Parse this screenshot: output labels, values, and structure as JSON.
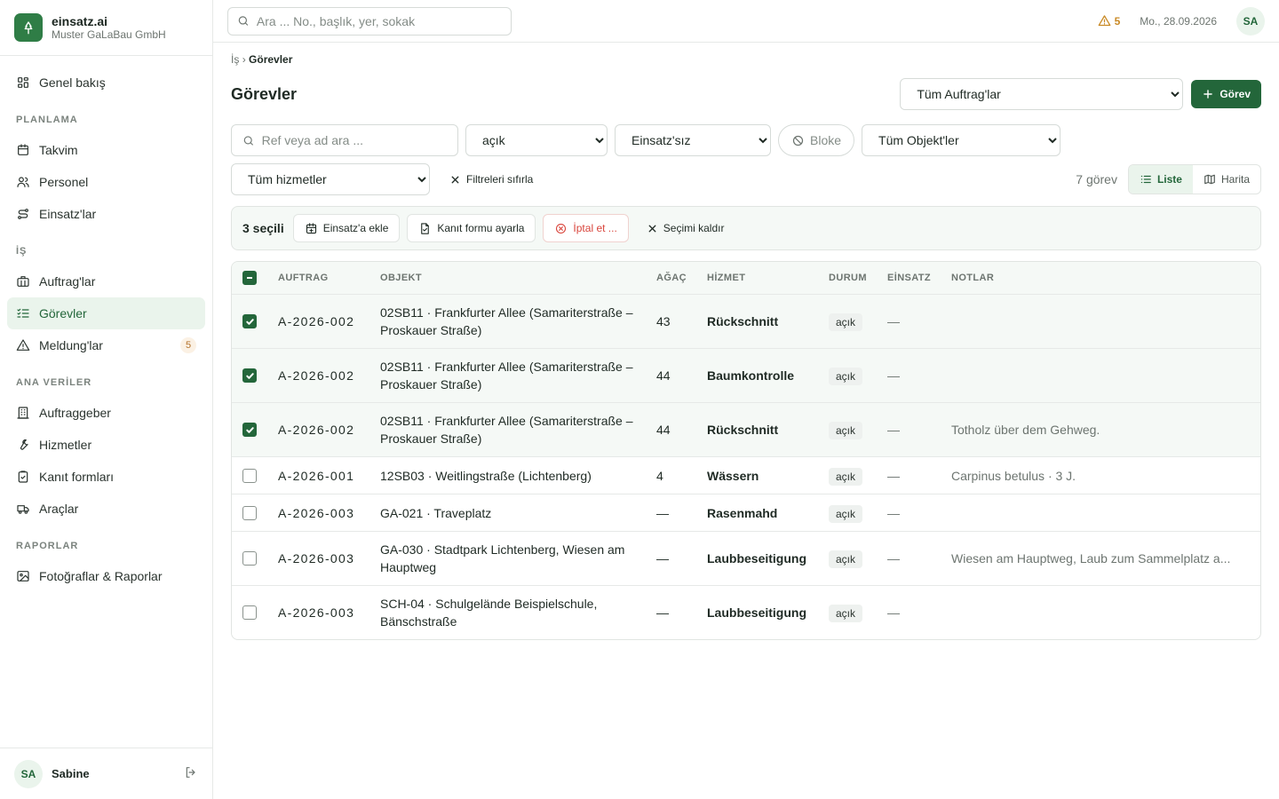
{
  "brand": {
    "name": "einsatz.ai",
    "org": "Muster GaLaBau GmbH"
  },
  "sidebar": {
    "items": [
      {
        "label": "Genel bakış",
        "icon": "grid-icon"
      },
      {
        "section": "PLANLAMA"
      },
      {
        "label": "Takvim",
        "icon": "calendar-icon"
      },
      {
        "label": "Personel",
        "icon": "users-icon"
      },
      {
        "label": "Einsatz'lar",
        "icon": "route-icon"
      },
      {
        "section": "İŞ"
      },
      {
        "label": "Auftrag'lar",
        "icon": "briefcase-icon"
      },
      {
        "label": "Görevler",
        "icon": "checklist-icon",
        "active": true
      },
      {
        "label": "Meldung'lar",
        "icon": "warning-icon",
        "count": "5"
      },
      {
        "section": "ANA VERİLER"
      },
      {
        "label": "Auftraggeber",
        "icon": "building-icon"
      },
      {
        "label": "Hizmetler",
        "icon": "wrench-icon"
      },
      {
        "label": "Kanıt formları",
        "icon": "clipboard-icon"
      },
      {
        "label": "Araçlar",
        "icon": "truck-icon"
      },
      {
        "section": "RAPORLAR"
      },
      {
        "label": "Fotoğraflar & Raporlar",
        "icon": "image-icon"
      }
    ],
    "user": {
      "initials": "SA",
      "name": "Sabine"
    }
  },
  "topbar": {
    "search_placeholder": "Ara ... No., başlık, yer, sokak",
    "warnings": "5",
    "date": "Mo., 28.09.2026",
    "user_initials": "SA"
  },
  "breadcrumb": {
    "parent": "İş",
    "sep": "›",
    "current": "Görevler"
  },
  "page": {
    "title": "Görevler",
    "auftrag_filter": "Tüm Auftrag'lar",
    "new_button": "Görev"
  },
  "filters": {
    "search_placeholder": "Ref veya ad ara ...",
    "status": "açık",
    "einsatz": "Einsatz'sız",
    "bloke": "Bloke",
    "objekt": "Tüm Objekt'ler",
    "hizmet": "Tüm hizmetler",
    "reset": "Filtreleri sıfırla",
    "count": "7 görev",
    "view_list": "Liste",
    "view_map": "Harita"
  },
  "bulk": {
    "selected": "3 seçili",
    "add_einsatz": "Einsatz'a ekle",
    "proof_form": "Kanıt formu ayarla",
    "cancel": "İptal et ...",
    "clear": "Seçimi kaldır"
  },
  "table": {
    "headers": {
      "auftrag": "AUFTRAG",
      "objekt": "OBJEKT",
      "agac": "AĞAÇ",
      "hizmet": "HİZMET",
      "durum": "DURUM",
      "einsatz": "EİNSATZ",
      "notlar": "NOTLAR"
    },
    "rows": [
      {
        "selected": true,
        "auftrag": "A-2026-002",
        "objekt": "02SB11 · Frankfurter Allee (Samariterstraße – Proskauer Straße)",
        "agac": "43",
        "hizmet": "Rückschnitt",
        "durum": "açık",
        "einsatz": "—",
        "notlar": ""
      },
      {
        "selected": true,
        "auftrag": "A-2026-002",
        "objekt": "02SB11 · Frankfurter Allee (Samariterstraße – Proskauer Straße)",
        "agac": "44",
        "hizmet": "Baumkontrolle",
        "durum": "açık",
        "einsatz": "—",
        "notlar": ""
      },
      {
        "selected": true,
        "auftrag": "A-2026-002",
        "objekt": "02SB11 · Frankfurter Allee (Samariterstraße – Proskauer Straße)",
        "agac": "44",
        "hizmet": "Rückschnitt",
        "durum": "açık",
        "einsatz": "—",
        "notlar": "Totholz über dem Gehweg."
      },
      {
        "selected": false,
        "auftrag": "A-2026-001",
        "objekt": "12SB03 · Weitlingstraße (Lichtenberg)",
        "agac": "4",
        "hizmet": "Wässern",
        "durum": "açık",
        "einsatz": "—",
        "notlar": "Carpinus betulus · 3 J."
      },
      {
        "selected": false,
        "auftrag": "A-2026-003",
        "objekt": "GA-021 · Traveplatz",
        "agac": "—",
        "hizmet": "Rasenmahd",
        "durum": "açık",
        "einsatz": "—",
        "notlar": ""
      },
      {
        "selected": false,
        "auftrag": "A-2026-003",
        "objekt": "GA-030 · Stadtpark Lichtenberg, Wiesen am Hauptweg",
        "agac": "—",
        "hizmet": "Laubbeseitigung",
        "durum": "açık",
        "einsatz": "—",
        "notlar": "Wiesen am Hauptweg, Laub zum Sammelplatz a..."
      },
      {
        "selected": false,
        "auftrag": "A-2026-003",
        "objekt": "SCH-04 · Schulgelände Beispielschule, Bänschstraße",
        "agac": "—",
        "hizmet": "Laubbeseitigung",
        "durum": "açık",
        "einsatz": "—",
        "notlar": ""
      }
    ]
  },
  "colors": {
    "accent": "#23663a",
    "accent_bg": "#eaf4ec",
    "warning": "#c98a26",
    "danger": "#d9453c"
  }
}
